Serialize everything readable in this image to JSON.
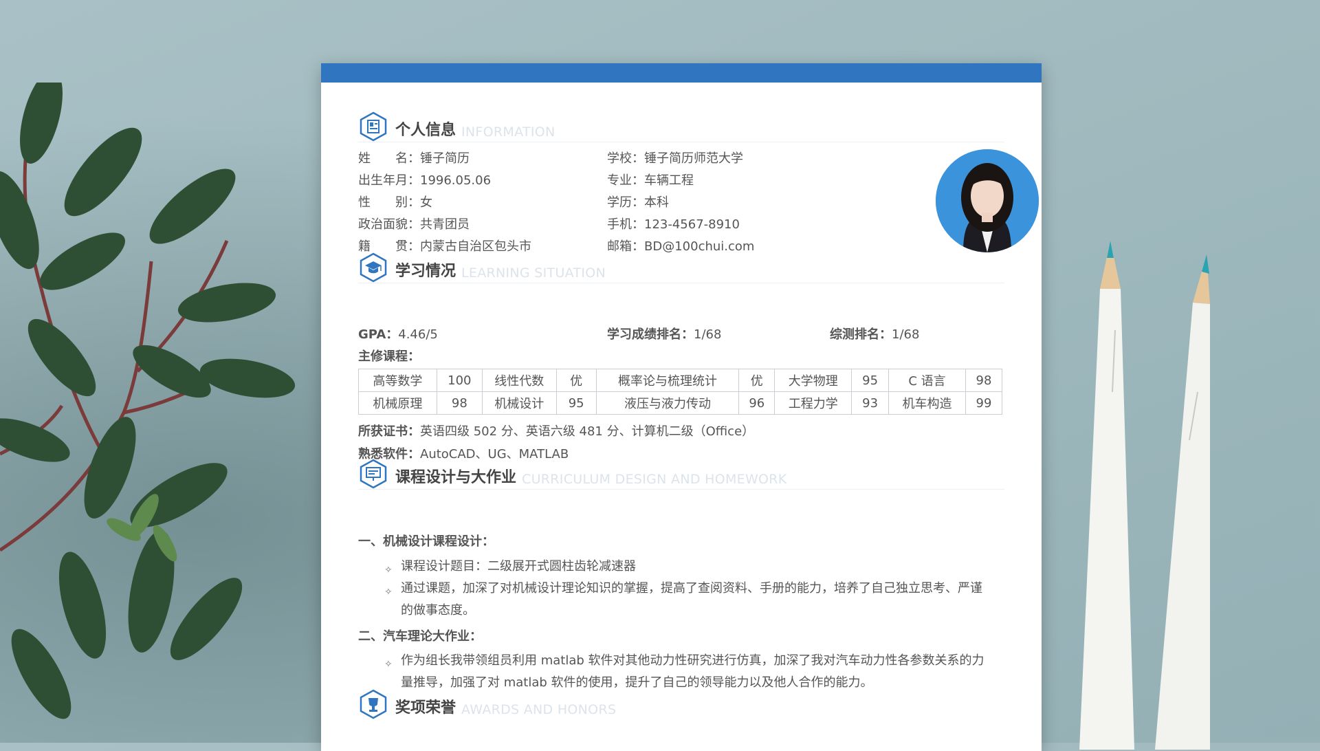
{
  "sections": {
    "info": {
      "title": "个人信息",
      "en": "INFORMATION"
    },
    "study": {
      "title": "学习情况",
      "en": "LEARNING SITUATION"
    },
    "course": {
      "title": "课程设计与大作业",
      "en": "CURRICULUM DESIGN AND HOMEWORK"
    },
    "awards": {
      "title": "奖项荣誉",
      "en": "AWARDS AND HONORS"
    }
  },
  "info": {
    "left": [
      {
        "label": "姓　　名：",
        "value": "锤子简历"
      },
      {
        "label": "出生年月：",
        "value": "1996.05.06"
      },
      {
        "label": "性　　别：",
        "value": "女"
      },
      {
        "label": "政治面貌：",
        "value": "共青团员"
      },
      {
        "label": "籍　　贯：",
        "value": "内蒙古自治区包头市"
      }
    ],
    "right": [
      {
        "label": "学校：",
        "value": "锤子简历师范大学"
      },
      {
        "label": "专业：",
        "value": "车辆工程"
      },
      {
        "label": "学历：",
        "value": "本科"
      },
      {
        "label": "手机：",
        "value": "123-4567-8910"
      },
      {
        "label": "邮箱：",
        "value": "BD@100chui.com"
      }
    ]
  },
  "study": {
    "gpa_label": "GPA：",
    "gpa": "4.46/5",
    "rank_label": "学习成绩排名：",
    "rank": "1/68",
    "overall_label": "综测排名：",
    "overall": "1/68",
    "courses_label": "主修课程：",
    "courses": [
      [
        "高等数学",
        "100",
        "线性代数",
        "优",
        "概率论与梳理统计",
        "优",
        "大学物理",
        "95",
        "C 语言",
        "98"
      ],
      [
        "机械原理",
        "98",
        "机械设计",
        "95",
        "液压与液力传动",
        "96",
        "工程力学",
        "93",
        "机车构造",
        "99"
      ]
    ],
    "cert_label": "所获证书：",
    "cert": "英语四级 502 分、英语六级 481 分、计算机二级（Office）",
    "software_label": "熟悉软件：",
    "software": "AutoCAD、UG、MATLAB"
  },
  "course_design": {
    "item1_title": "一、机械设计课程设计：",
    "item1_bullet1": "课程设计题目：二级展开式圆柱齿轮减速器",
    "item1_bullet2_line1": "通过课题，加深了对机械设计理论知识的掌握，提高了查阅资料、手册的能力，培养了自己独立思考、严谨",
    "item1_bullet2_line2": "的做事态度。",
    "item2_title": "二、汽车理论大作业：",
    "item2_bullet1_line1": "作为组长我带领组员利用 matlab 软件对其他动力性研究进行仿真，加深了我对汽车动力性各参数关系的力",
    "item2_bullet1_line2": "量推导，加强了对 matlab 软件的使用，提升了自己的领导能力以及他人合作的能力。"
  },
  "colors": {
    "accent": "#2f75bf",
    "photo_bg": "#3b93dc"
  },
  "icons": [
    "id-card-icon",
    "graduation-cap-icon",
    "presentation-icon",
    "trophy-icon",
    "diamond-bullet-icon"
  ]
}
